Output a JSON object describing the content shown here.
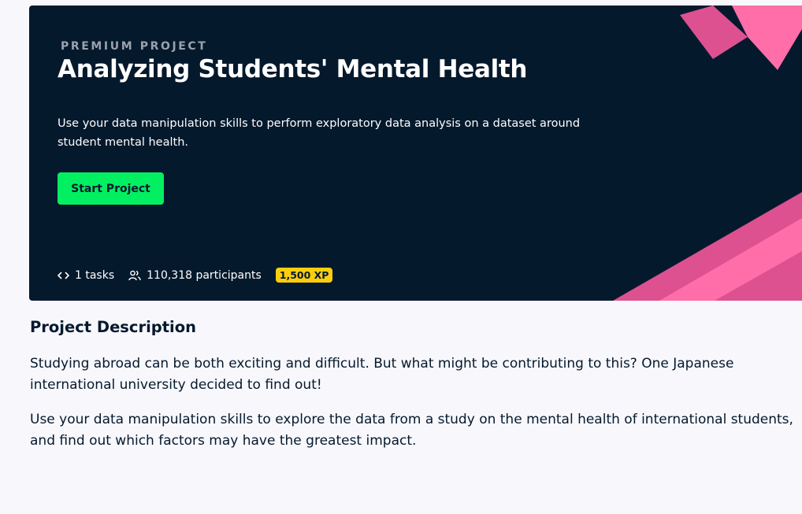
{
  "hero": {
    "eyebrow": "PREMIUM PROJECT",
    "title": "Analyzing Students' Mental Health",
    "description": "Use your data manipulation skills to perform exploratory data analysis on a dataset around student mental health.",
    "start_button": "Start Project",
    "tasks": "1 tasks",
    "participants": "110,318 participants",
    "xp": "1,500 XP",
    "colors": {
      "background": "#05192d",
      "accent_green": "#03ef62",
      "accent_pink": "#ff6ea9",
      "xp_yellow": "#fcce0d"
    }
  },
  "description_section": {
    "title": "Project Description",
    "paragraphs": [
      "Studying abroad can be both exciting and difficult. But what might be contributing to this? One Japanese international university decided to find out!",
      "Use your data manipulation skills to explore the data from a study on the mental health of international students, and find out which factors may have the greatest impact."
    ]
  }
}
